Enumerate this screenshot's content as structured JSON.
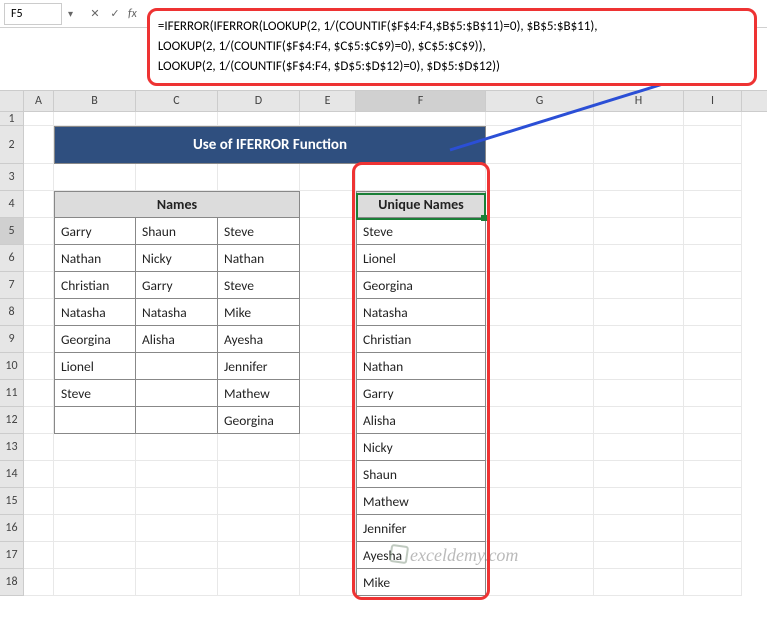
{
  "name_box": "F5",
  "fx_label": "fx",
  "formula_lines": [
    "=IFERROR(IFERROR(LOOKUP(2, 1/(COUNTIF($F$4:F4,$B$5:$B$11)=0), $B$5:$B$11),",
    "LOOKUP(2, 1/(COUNTIF($F$4:F4, $C$5:$C$9)=0), $C$5:$C$9)),",
    "LOOKUP(2, 1/(COUNTIF($F$4:F4, $D$5:$D$12)=0), $D$5:$D$12))"
  ],
  "columns": [
    "A",
    "B",
    "C",
    "D",
    "E",
    "F",
    "G",
    "H",
    "I"
  ],
  "row_numbers": [
    "1",
    "2",
    "3",
    "4",
    "5",
    "6",
    "7",
    "8",
    "9",
    "10",
    "11",
    "12",
    "13",
    "14",
    "15",
    "16",
    "17",
    "18"
  ],
  "title": "Use of IFERROR Function",
  "names_header": "Names",
  "unique_header": "Unique Names",
  "names_table": [
    [
      "Garry",
      "Shaun",
      "Steve"
    ],
    [
      "Nathan",
      "Nicky",
      "Nathan"
    ],
    [
      "Christian",
      "Garry",
      "Steve"
    ],
    [
      "Natasha",
      "Natasha",
      "Mike"
    ],
    [
      "Georgina",
      "Alisha",
      "Ayesha"
    ],
    [
      "Lionel",
      "",
      "Jennifer"
    ],
    [
      "Steve",
      "",
      "Mathew"
    ],
    [
      "",
      "",
      "Georgina"
    ]
  ],
  "unique_list": [
    "Steve",
    "Lionel",
    "Georgina",
    "Natasha",
    "Christian",
    "Nathan",
    "Garry",
    "Alisha",
    "Nicky",
    "Shaun",
    "Mathew",
    "Jennifer",
    "Ayesha",
    "Mike"
  ],
  "watermark": "exceldemy.com"
}
